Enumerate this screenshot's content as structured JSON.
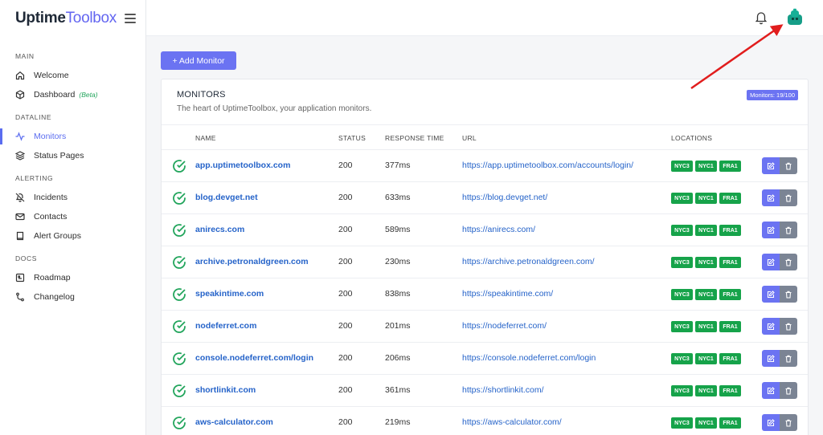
{
  "brand": {
    "part1": "Uptime",
    "part2": "Toolbox"
  },
  "sidebar": {
    "sections": [
      {
        "title": "MAIN",
        "items": [
          {
            "label": "Welcome",
            "icon": "home-icon"
          },
          {
            "label": "Dashboard",
            "icon": "cube-icon",
            "badge": "(Beta)"
          }
        ]
      },
      {
        "title": "DATALINE",
        "items": [
          {
            "label": "Monitors",
            "icon": "activity-icon",
            "active": true
          },
          {
            "label": "Status Pages",
            "icon": "layers-icon"
          }
        ]
      },
      {
        "title": "ALERTING",
        "items": [
          {
            "label": "Incidents",
            "icon": "bell-off-icon"
          },
          {
            "label": "Contacts",
            "icon": "mail-icon"
          },
          {
            "label": "Alert Groups",
            "icon": "book-icon"
          }
        ]
      },
      {
        "title": "DOCS",
        "items": [
          {
            "label": "Roadmap",
            "icon": "map-icon"
          },
          {
            "label": "Changelog",
            "icon": "git-icon"
          }
        ]
      }
    ]
  },
  "toolbar": {
    "add_monitor_label": "+ Add Monitor"
  },
  "monitors": {
    "title": "MONITORS",
    "subtitle": "The heart of UptimeToolbox, your application monitors.",
    "count_badge": "Monitors: 19/100",
    "columns": {
      "name": "NAME",
      "status": "STATUS",
      "response_time": "RESPONSE TIME",
      "url": "URL",
      "locations": "LOCATIONS"
    },
    "rows": [
      {
        "name": "app.uptimetoolbox.com",
        "status": "200",
        "response_time": "377ms",
        "url": "https://app.uptimetoolbox.com/accounts/login/",
        "locations": [
          "NYC3",
          "NYC1",
          "FRA1"
        ]
      },
      {
        "name": "blog.devget.net",
        "status": "200",
        "response_time": "633ms",
        "url": "https://blog.devget.net/",
        "locations": [
          "NYC3",
          "NYC1",
          "FRA1"
        ]
      },
      {
        "name": "anirecs.com",
        "status": "200",
        "response_time": "589ms",
        "url": "https://anirecs.com/",
        "locations": [
          "NYC3",
          "NYC1",
          "FRA1"
        ]
      },
      {
        "name": "archive.petronaldgreen.com",
        "status": "200",
        "response_time": "230ms",
        "url": "https://archive.petronaldgreen.com/",
        "locations": [
          "NYC3",
          "NYC1",
          "FRA1"
        ]
      },
      {
        "name": "speakintime.com",
        "status": "200",
        "response_time": "838ms",
        "url": "https://speakintime.com/",
        "locations": [
          "NYC3",
          "NYC1",
          "FRA1"
        ]
      },
      {
        "name": "nodeferret.com",
        "status": "200",
        "response_time": "201ms",
        "url": "https://nodeferret.com/",
        "locations": [
          "NYC3",
          "NYC1",
          "FRA1"
        ]
      },
      {
        "name": "console.nodeferret.com/login",
        "status": "200",
        "response_time": "206ms",
        "url": "https://console.nodeferret.com/login",
        "locations": [
          "NYC3",
          "NYC1",
          "FRA1"
        ]
      },
      {
        "name": "shortlinkit.com",
        "status": "200",
        "response_time": "361ms",
        "url": "https://shortlinkit.com/",
        "locations": [
          "NYC3",
          "NYC1",
          "FRA1"
        ]
      },
      {
        "name": "aws-calculator.com",
        "status": "200",
        "response_time": "219ms",
        "url": "https://aws-calculator.com/",
        "locations": [
          "NYC3",
          "NYC1",
          "FRA1"
        ]
      }
    ]
  },
  "colors": {
    "accent": "#6b73f2",
    "link": "#2563c9",
    "success": "#16a34a",
    "annotation_arrow": "#e11d1d"
  }
}
